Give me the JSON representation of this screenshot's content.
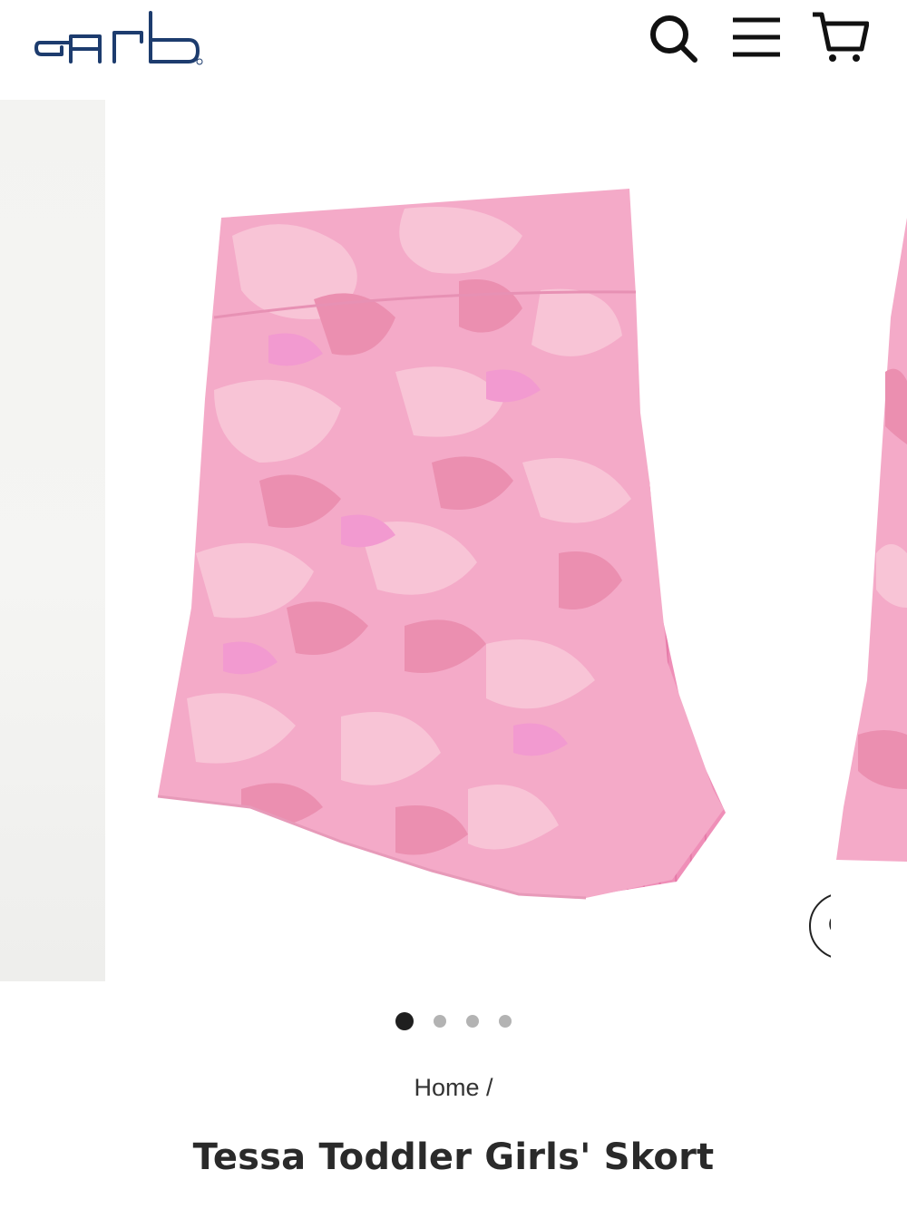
{
  "header": {
    "logo_text": "garb",
    "icons": [
      "search-icon",
      "menu-icon",
      "cart-icon"
    ],
    "brand_color": "#1d3c6e"
  },
  "gallery": {
    "slide_count": 4,
    "active_slide_index": 1,
    "product_colors": {
      "base": "#f4a6c4",
      "camo_light": "#f7bfd3",
      "camo_dark": "#ec8fb2",
      "camo_mid": "#f29cc6"
    }
  },
  "breadcrumb": {
    "home_label": "Home",
    "separator": "/"
  },
  "product": {
    "title": "Tessa Toddler Girls' Skort"
  }
}
